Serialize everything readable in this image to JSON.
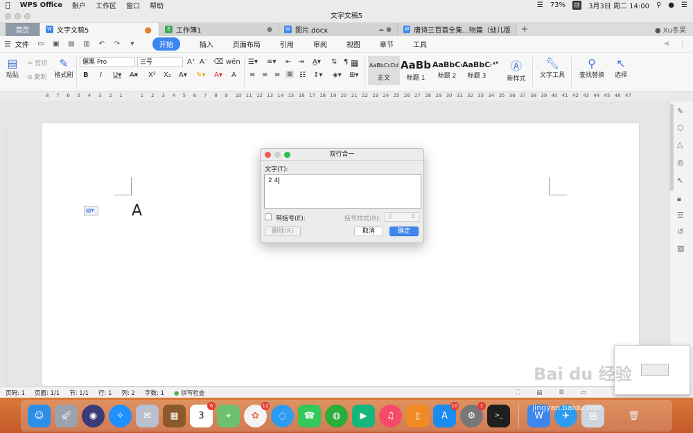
{
  "menubar": {
    "app": "WPS Office",
    "items": [
      "账户",
      "工作区",
      "窗口",
      "帮助"
    ],
    "battery": "73%",
    "ime": "拼",
    "datetime": "3月3日 周二  14:00"
  },
  "window": {
    "title": "文字文稿5"
  },
  "tabs": {
    "home": "首页",
    "items": [
      {
        "label": "文字文稿5",
        "icon": "W",
        "color": "#3c86ee"
      },
      {
        "label": "工作簿1",
        "icon": "S",
        "color": "#3bab5c"
      },
      {
        "label": "图片.docx",
        "icon": "W",
        "color": "#3c86ee"
      },
      {
        "label": "唐诗三百首全集...物篇（幼儿版）",
        "icon": "W",
        "color": "#3c86ee"
      }
    ],
    "user": "Xu冬呆"
  },
  "ribbon_tabs": {
    "file": "文件",
    "items": [
      "开始",
      "插入",
      "页面布局",
      "引用",
      "审阅",
      "视图",
      "章节",
      "工具"
    ],
    "active": "开始"
  },
  "ribbon": {
    "paste": "粘贴",
    "cut": "剪切",
    "copy": "复制",
    "format_painter": "格式刷",
    "font_name": "儷黑 Pro",
    "font_size": "三号",
    "styles": [
      {
        "preview": "AaBbCcDd",
        "name": "正文"
      },
      {
        "preview": "AaBb",
        "name": "标题 1"
      },
      {
        "preview": "AaBbCc",
        "name": "标题 2"
      },
      {
        "preview": "AaBbCc",
        "name": "标题 3"
      }
    ],
    "new_style": "新样式",
    "text_tools": "文字工具",
    "find_replace": "查找替换",
    "select": "选择"
  },
  "ruler": {
    "ticks": [
      "8",
      "7",
      "6",
      "5",
      "4",
      "3",
      "2",
      "1",
      "",
      "1",
      "2",
      "3",
      "4",
      "5",
      "6",
      "7",
      "8",
      "9",
      "10",
      "11",
      "12",
      "13",
      "14",
      "15",
      "16",
      "17",
      "18",
      "19",
      "20",
      "21",
      "22",
      "23",
      "24",
      "25",
      "26",
      "27",
      "28",
      "29",
      "30",
      "31",
      "32",
      "33",
      "34",
      "35",
      "36",
      "37",
      "38",
      "39",
      "40",
      "41",
      "42",
      "43",
      "44",
      "45",
      "46",
      "47"
    ]
  },
  "document": {
    "text": "A"
  },
  "dialog": {
    "title": "双行合一",
    "text_label": "文字(T):",
    "text_value": "2 4",
    "bracket_label": "带括号(E):",
    "bracket_style_label": "括号样式(B):",
    "bracket_style_value": "()",
    "delete": "删除(R)",
    "cancel": "取消",
    "ok": "确定"
  },
  "status": {
    "page_no": "页码: 1",
    "pages": "页面: 1/1",
    "section": "节: 1/1",
    "row": "行: 1",
    "col": "列: 2",
    "words": "字数: 1",
    "spell": "拼写检查"
  },
  "dock": {
    "badges": {
      "calendar": "6",
      "photos": "12",
      "appstore": "10",
      "sysprefs": "1"
    },
    "calendar_day": "3"
  },
  "watermark": {
    "logo": "Bai du 经验",
    "url": "jingyan.baidu.com"
  }
}
